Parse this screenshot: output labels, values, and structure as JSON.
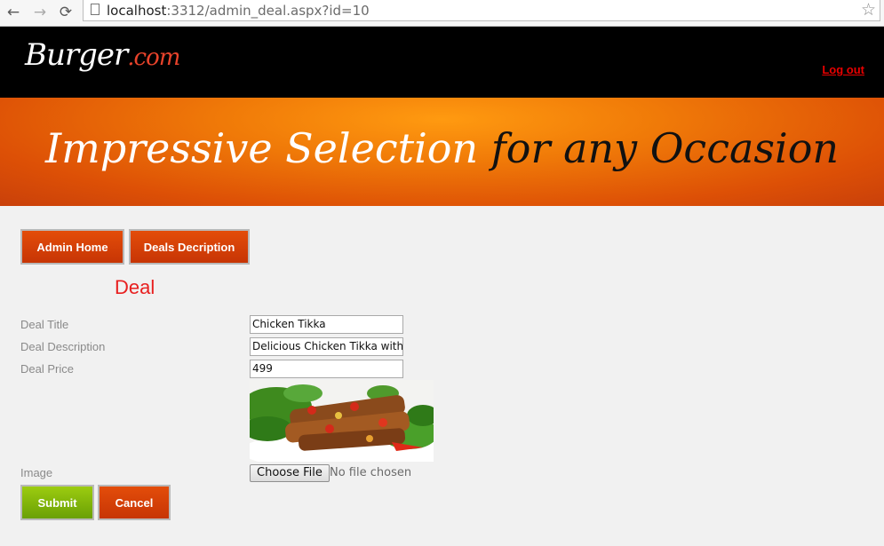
{
  "browser": {
    "url_host": "localhost",
    "url_rest": ":3312/admin_deal.aspx?id=10",
    "back_icon": "arrow-left-icon",
    "forward_icon": "arrow-right-icon",
    "reload_icon": "reload-icon",
    "star_icon": "star-icon"
  },
  "header": {
    "logo_main": "Burger",
    "logo_suffix": ".com",
    "logout_label": "Log out"
  },
  "banner": {
    "text_light": "Impressive Selection",
    "text_dark": " for any Occasion"
  },
  "nav": {
    "admin_home_label": "Admin Home",
    "deals_description_label": "Deals Decription"
  },
  "form": {
    "heading": "Deal",
    "title_label": "Deal Title",
    "title_value": "Chicken Tikka",
    "description_label": "Deal Description",
    "description_value": "Delicious Chicken Tikka with",
    "price_label": "Deal Price",
    "price_value": "499",
    "image_label": "Image",
    "choose_file_label": "Choose File",
    "no_file_text": "No file chosen",
    "submit_label": "Submit",
    "cancel_label": "Cancel"
  },
  "colors": {
    "accent_red": "#c73505",
    "accent_green": "#6aa004",
    "heading_red": "#e82020"
  }
}
